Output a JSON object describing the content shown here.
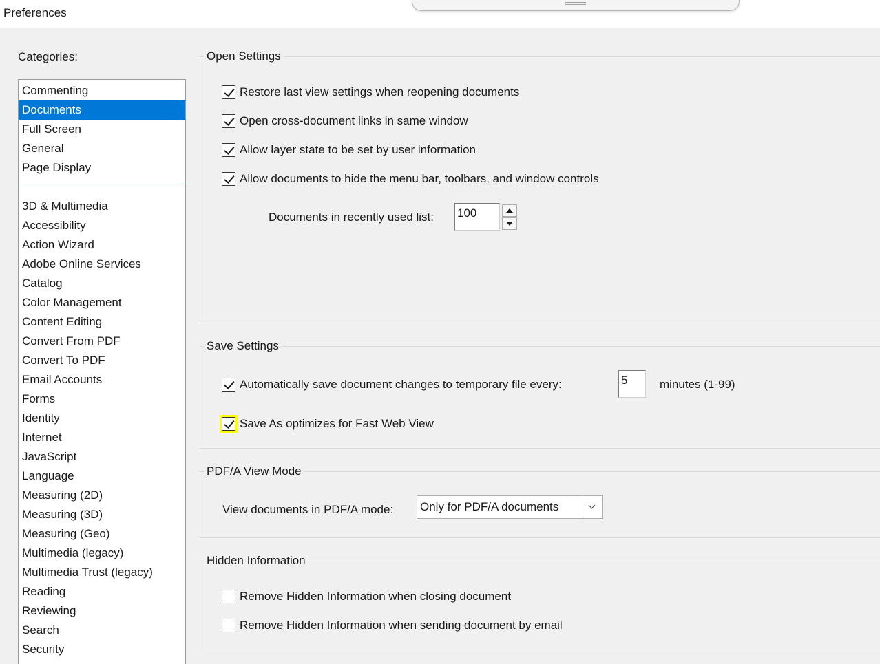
{
  "window": {
    "title": "Preferences"
  },
  "sidebar": {
    "label": "Categories:",
    "top_items": [
      "Commenting",
      "Documents",
      "Full Screen",
      "General",
      "Page Display"
    ],
    "selected": "Documents",
    "items": [
      "3D & Multimedia",
      "Accessibility",
      "Action Wizard",
      "Adobe Online Services",
      "Catalog",
      "Color Management",
      "Content Editing",
      "Convert From PDF",
      "Convert To PDF",
      "Email Accounts",
      "Forms",
      "Identity",
      "Internet",
      "JavaScript",
      "Language",
      "Measuring (2D)",
      "Measuring (3D)",
      "Measuring (Geo)",
      "Multimedia (legacy)",
      "Multimedia Trust (legacy)",
      "Reading",
      "Reviewing",
      "Search",
      "Security"
    ]
  },
  "open_settings": {
    "title": "Open Settings",
    "checks": [
      {
        "label": "Restore last view settings when reopening documents",
        "checked": true
      },
      {
        "label": "Open cross-document links in same window",
        "checked": true
      },
      {
        "label": "Allow layer state to be set by user information",
        "checked": true
      },
      {
        "label": "Allow documents to hide the menu bar, toolbars, and window controls",
        "checked": true
      }
    ],
    "recent_label": "Documents in recently used list:",
    "recent_value": "100"
  },
  "save_settings": {
    "title": "Save Settings",
    "autosave_label": "Automatically save document changes to temporary file every:",
    "autosave_checked": true,
    "autosave_value": "5",
    "minutes_label": "minutes (1-99)",
    "fastweb_label": "Save As optimizes for Fast Web View",
    "fastweb_checked": true,
    "highlight_color": "#ffff00"
  },
  "pdfa": {
    "title": "PDF/A View Mode",
    "label": "View documents in PDF/A mode:",
    "selected": "Only for PDF/A documents"
  },
  "hidden_info": {
    "title": "Hidden Information",
    "checks": [
      {
        "label": "Remove Hidden Information when closing document",
        "checked": false
      },
      {
        "label": "Remove Hidden Information when sending document by email",
        "checked": false
      }
    ]
  },
  "colors": {
    "accent": "#0078d7",
    "background": "#f0f0f0"
  }
}
